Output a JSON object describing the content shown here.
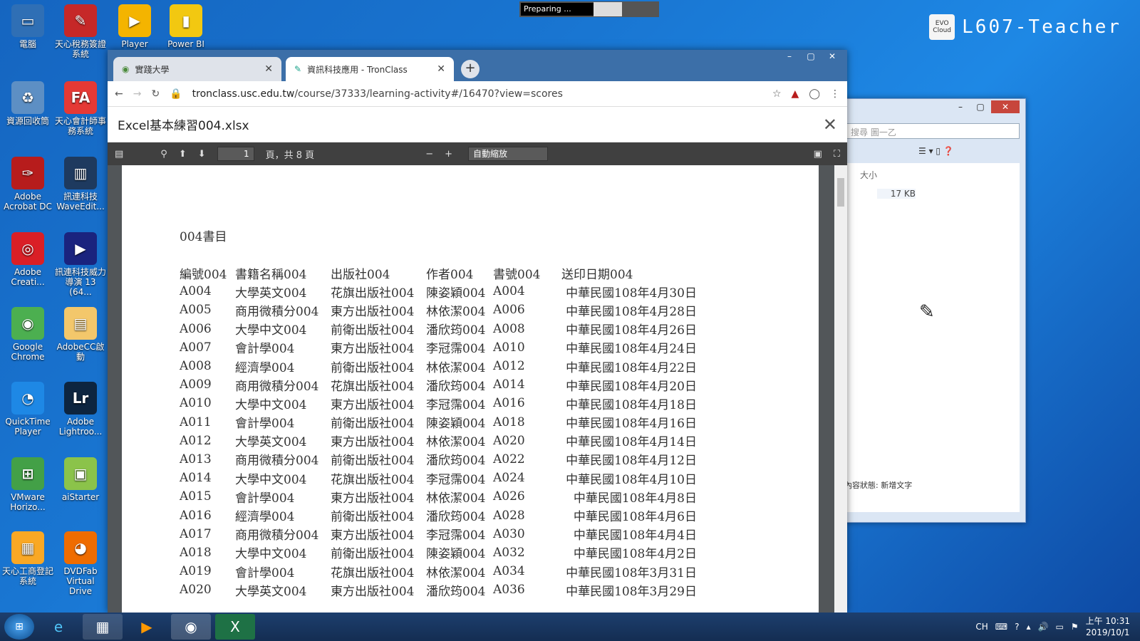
{
  "desktop": {
    "icons": [
      {
        "label": "電腦",
        "color": "#2f6fb5"
      },
      {
        "label": "天心稅務簽證系統",
        "color": "#c62828"
      },
      {
        "label": "Player",
        "color": "#f4b400"
      },
      {
        "label": "Power BI",
        "color": "#f2c811"
      },
      {
        "label": "資源回收筒",
        "color": "#5d8fc4"
      },
      {
        "label": "天心會計師事務系統",
        "color": "#e53935"
      },
      {
        "label": "Adobe Acrobat DC",
        "color": "#b71c1c"
      },
      {
        "label": "訊連科技 WaveEdit...",
        "color": "#1e3a5f"
      },
      {
        "label": "Adobe Creati...",
        "color": "#da1f26"
      },
      {
        "label": "訊連科技威力導演 13 (64...",
        "color": "#1a237e"
      },
      {
        "label": "Google Chrome",
        "color": "#4caf50"
      },
      {
        "label": "AdobeCC啟動",
        "color": "#f3c76b"
      },
      {
        "label": "QuickTime Player",
        "color": "#1e88e5"
      },
      {
        "label": "Adobe Lightroo...",
        "color": "#0d2540"
      },
      {
        "label": "VMware Horizo...",
        "color": "#43a047"
      },
      {
        "label": "aiStarter",
        "color": "#8bc34a"
      },
      {
        "label": "天心工商登記系統",
        "color": "#f9a825"
      },
      {
        "label": "DVDFab Virtual Drive",
        "color": "#ef6c00"
      }
    ],
    "icon_glyphs": [
      "▭",
      "✎",
      "▶",
      "▮",
      "♻",
      "FA",
      "✑",
      "▥",
      "◎",
      "▶",
      "◉",
      "▤",
      "◔",
      "Lr",
      "⊞",
      "▣",
      "▦",
      "◕"
    ],
    "brand_logo": "EVO Cloud",
    "brand_name": "L607-Teacher",
    "preparing": "Preparing ..."
  },
  "explorer": {
    "search_placeholder": "搜尋 圖一乙",
    "col_size": "大小",
    "file_size": "17 KB",
    "status_label": "內容狀態:",
    "status_value": "新增文字"
  },
  "browser": {
    "tabs": [
      {
        "label": "實踐大學",
        "active": false
      },
      {
        "label": "資訊科技應用 - TronClass",
        "active": true
      }
    ],
    "url_host": "tronclass.usc.edu.tw",
    "url_path": "/course/37333/learning-activity#/16470?view=scores"
  },
  "viewer": {
    "file_title": "Excel基本練習004.xlsx",
    "page_current": "1",
    "page_total_label": "頁，共 8 頁",
    "zoom": "自動縮放",
    "sheet_title": "004書目",
    "headers": [
      "編號004",
      "書籍名稱004",
      "出版社004",
      "作者004",
      "書號004",
      "送印日期004"
    ],
    "rows": [
      [
        "A004",
        "大學英文004",
        "花旗出版社004",
        "陳姿穎004",
        "A004",
        "中華民國108年4月30日"
      ],
      [
        "A005",
        "商用微積分004",
        "東方出版社004",
        "林依潔004",
        "A006",
        "中華民國108年4月28日"
      ],
      [
        "A006",
        "大學中文004",
        "前衛出版社004",
        "潘欣筠004",
        "A008",
        "中華民國108年4月26日"
      ],
      [
        "A007",
        "會計學004",
        "東方出版社004",
        "李冠霈004",
        "A010",
        "中華民國108年4月24日"
      ],
      [
        "A008",
        "經濟學004",
        "前衛出版社004",
        "林依潔004",
        "A012",
        "中華民國108年4月22日"
      ],
      [
        "A009",
        "商用微積分004",
        "花旗出版社004",
        "潘欣筠004",
        "A014",
        "中華民國108年4月20日"
      ],
      [
        "A010",
        "大學中文004",
        "東方出版社004",
        "李冠霈004",
        "A016",
        "中華民國108年4月18日"
      ],
      [
        "A011",
        "會計學004",
        "前衛出版社004",
        "陳姿穎004",
        "A018",
        "中華民國108年4月16日"
      ],
      [
        "A012",
        "大學英文004",
        "東方出版社004",
        "林依潔004",
        "A020",
        "中華民國108年4月14日"
      ],
      [
        "A013",
        "商用微積分004",
        "前衛出版社004",
        "潘欣筠004",
        "A022",
        "中華民國108年4月12日"
      ],
      [
        "A014",
        "大學中文004",
        "花旗出版社004",
        "李冠霈004",
        "A024",
        "中華民國108年4月10日"
      ],
      [
        "A015",
        "會計學004",
        "東方出版社004",
        "林依潔004",
        "A026",
        "中華民國108年4月8日"
      ],
      [
        "A016",
        "經濟學004",
        "前衛出版社004",
        "潘欣筠004",
        "A028",
        "中華民國108年4月6日"
      ],
      [
        "A017",
        "商用微積分004",
        "東方出版社004",
        "李冠霈004",
        "A030",
        "中華民國108年4月4日"
      ],
      [
        "A018",
        "大學中文004",
        "前衛出版社004",
        "陳姿穎004",
        "A032",
        "中華民國108年4月2日"
      ],
      [
        "A019",
        "會計學004",
        "花旗出版社004",
        "林依潔004",
        "A034",
        "中華民國108年3月31日"
      ],
      [
        "A020",
        "大學英文004",
        "東方出版社004",
        "潘欣筠004",
        "A036",
        "中華民國108年3月29日"
      ]
    ]
  },
  "taskbar": {
    "lang": "CH",
    "time": "上午 10:31",
    "date": "2019/10/1"
  }
}
